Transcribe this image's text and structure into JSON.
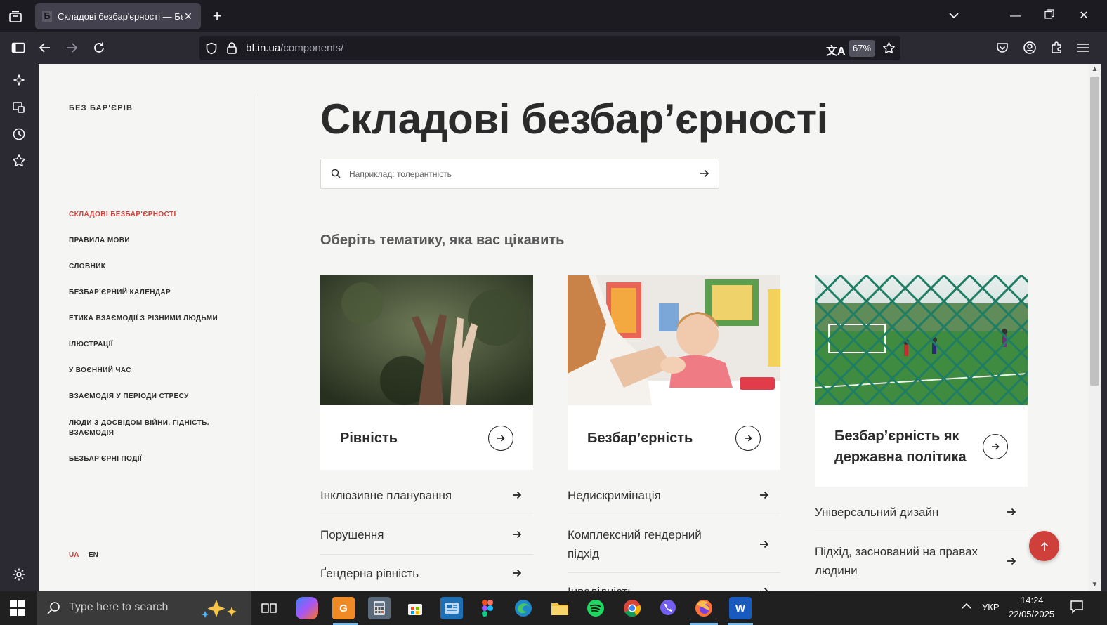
{
  "browser": {
    "tab_title": "Складові безбар'єрності — Бе",
    "tab_favicon": "Б",
    "url_host": "bf.in.ua",
    "url_path": "/components/",
    "zoom": "67%"
  },
  "site": {
    "brand": "БЕЗ БАР'ЄРІВ",
    "nav": [
      {
        "label": "СКЛАДОВІ БЕЗБАР'ЄРНОСТІ",
        "active": true
      },
      {
        "label": "ПРАВИЛА МОВИ"
      },
      {
        "label": "СЛОВНИК"
      },
      {
        "label": "БЕЗБАР'ЄРНИЙ КАЛЕНДАР"
      },
      {
        "label": "ЕТИКА ВЗАЄМОДІЇ З РІЗНИМИ ЛЮДЬМИ"
      },
      {
        "label": "ІЛЮСТРАЦІЇ"
      },
      {
        "label": "У ВОЄННИЙ ЧАС"
      },
      {
        "label": "ВЗАЄМОДІЯ У ПЕРІОДИ СТРЕСУ"
      },
      {
        "label": "ЛЮДИ З ДОСВІДОМ ВІЙНИ. ГІДНІСТЬ. ВЗАЄМОДІЯ"
      },
      {
        "label": "БЕЗБАР'ЄРНІ ПОДІЇ"
      }
    ],
    "lang": {
      "ua": "UA",
      "en": "EN"
    }
  },
  "main": {
    "title": "Складові безбар’єрності",
    "search_placeholder": "Наприклад: толерантність",
    "section_title": "Оберіть тематику, яка вас цікавить",
    "cards": [
      {
        "label": "Рівність",
        "links": [
          "Інклюзивне планування",
          "Порушення",
          "Ґендерна рівність"
        ]
      },
      {
        "label": "Безбар’єрність",
        "links": [
          "Недискримінація",
          "Комплексний гендерний підхід",
          "Інвалідність"
        ]
      },
      {
        "label": "Безбар’єрність як державна політика",
        "links": [
          "Універсальний дизайн",
          "Підхід, заснований на правах людини"
        ]
      }
    ]
  },
  "taskbar": {
    "search_placeholder": "Type here to search",
    "lang": "УКР",
    "time": "14:24",
    "date": "22/05/2025"
  },
  "colors": {
    "accent": "#d0403a",
    "chrome_dark": "#1c1b22",
    "chrome_bar": "#2b2a33",
    "page_bg": "#f5f5f4"
  }
}
